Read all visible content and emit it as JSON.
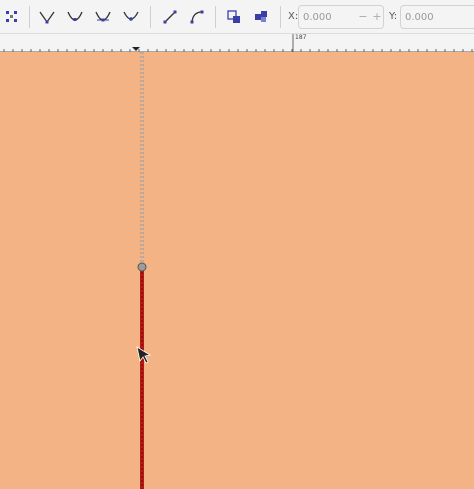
{
  "toolbar": {
    "buttons": [
      {
        "name": "select-all-nodes-button",
        "icon": "nodes-select-icon"
      },
      {
        "name": "node-cusp-button",
        "icon": "node-cusp-icon"
      },
      {
        "name": "node-smooth-button",
        "icon": "node-smooth-icon"
      },
      {
        "name": "node-symmetric-button",
        "icon": "node-symmetric-icon"
      },
      {
        "name": "node-auto-button",
        "icon": "node-auto-icon"
      },
      {
        "name": "segment-line-button",
        "icon": "segment-line-icon"
      },
      {
        "name": "segment-curve-button",
        "icon": "segment-curve-icon"
      },
      {
        "name": "object-to-path-button",
        "icon": "object-to-path-icon"
      },
      {
        "name": "stroke-to-path-button",
        "icon": "stroke-to-path-icon"
      }
    ],
    "x_label": "X:",
    "x_value": "0.000",
    "y_label": "Y:",
    "y_value": "0.000",
    "spin_minus": "−",
    "spin_plus": "+"
  },
  "ruler": {
    "label": "187"
  },
  "colors": {
    "canvas": "#f3b385",
    "path_stroke": "#b51a12",
    "icon_accent": "#3a3fa8"
  }
}
